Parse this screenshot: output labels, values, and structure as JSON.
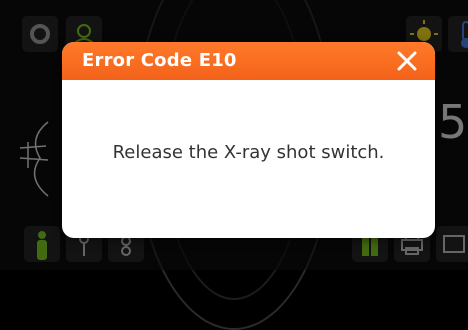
{
  "dialog": {
    "title": "Error Code E10",
    "message": "Release the X-ray shot switch.",
    "close_icon": "close-icon"
  },
  "background": {
    "partial_value": "5"
  },
  "colors": {
    "header_orange": "#f4621a",
    "indicator_green": "#79c21e",
    "indicator_yellow": "#e6d21a",
    "indicator_blue": "#3d7fe0",
    "tile_gray": "#242424"
  },
  "icons": {
    "top_left": [
      "gear-icon",
      "user-settings-icon"
    ],
    "top_right": [
      "sun-icon",
      "thermometer-icon"
    ],
    "bottom_left": [
      "patient-standing-icon",
      "patient-child-icon",
      "patient-small-icon"
    ],
    "bottom_right": [
      "film-icon",
      "printer-icon",
      "screen-icon"
    ]
  }
}
